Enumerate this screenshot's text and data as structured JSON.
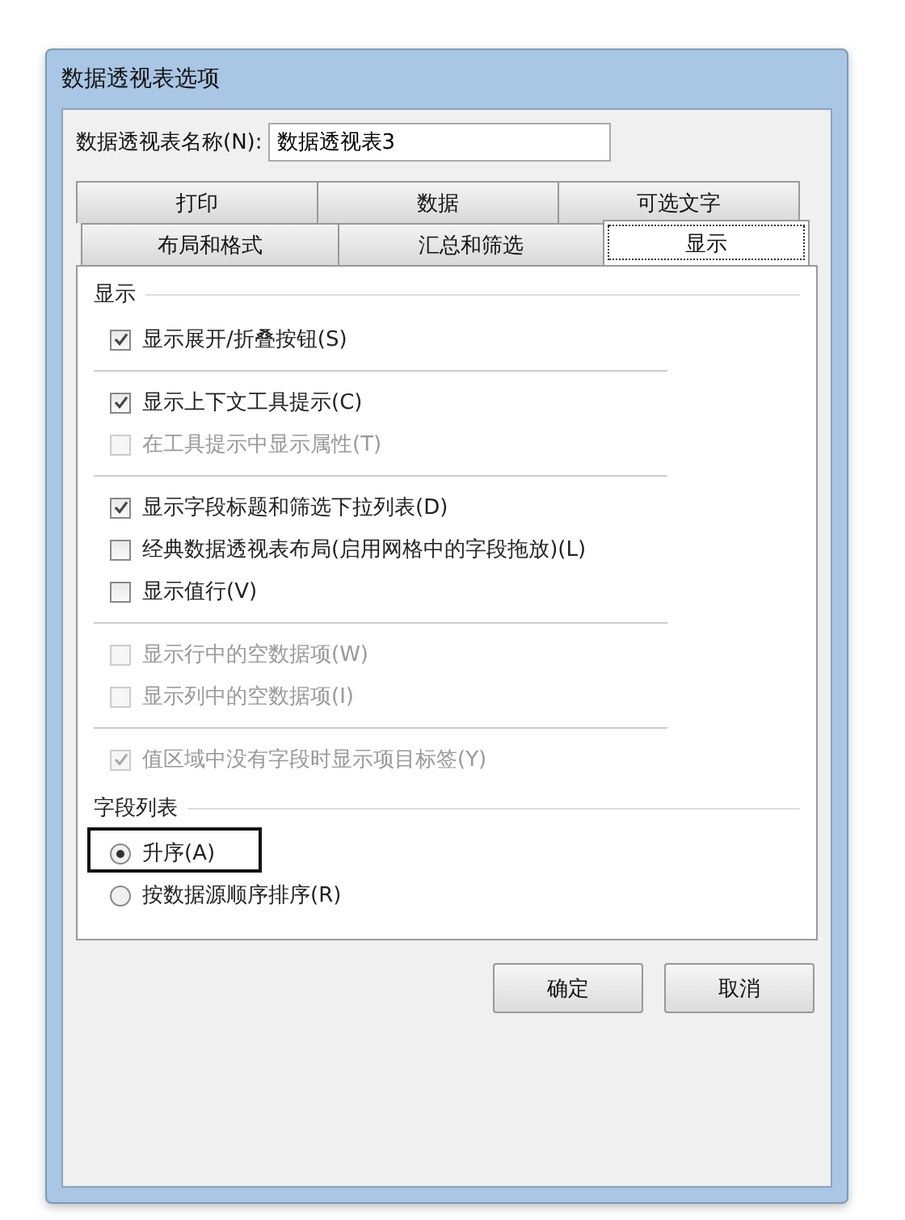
{
  "window": {
    "title": "数据透视表选项"
  },
  "name_field": {
    "label": "数据透视表名称(N):",
    "value": "数据透视表3"
  },
  "tab_rows": [
    [
      {
        "label": "打印",
        "selected": false
      },
      {
        "label": "数据",
        "selected": false
      },
      {
        "label": "可选文字",
        "selected": false
      }
    ],
    [
      {
        "label": "布局和格式",
        "selected": false
      },
      {
        "label": "汇总和筛选",
        "selected": false
      },
      {
        "label": "显示",
        "selected": true
      }
    ]
  ],
  "display_section": {
    "title": "显示",
    "groups": [
      [
        {
          "label": "显示展开/折叠按钮(S)",
          "checked": true,
          "disabled": false
        }
      ],
      [
        {
          "label": "显示上下文工具提示(C)",
          "checked": true,
          "disabled": false
        },
        {
          "label": "在工具提示中显示属性(T)",
          "checked": false,
          "disabled": true
        }
      ],
      [
        {
          "label": "显示字段标题和筛选下拉列表(D)",
          "checked": true,
          "disabled": false
        },
        {
          "label": "经典数据透视表布局(启用网格中的字段拖放)(L)",
          "checked": false,
          "disabled": false
        },
        {
          "label": "显示值行(V)",
          "checked": false,
          "disabled": false
        }
      ],
      [
        {
          "label": "显示行中的空数据项(W)",
          "checked": false,
          "disabled": true
        },
        {
          "label": "显示列中的空数据项(I)",
          "checked": false,
          "disabled": true
        }
      ],
      [
        {
          "label": "值区域中没有字段时显示项目标签(Y)",
          "checked": true,
          "disabled": true
        }
      ]
    ]
  },
  "field_list_section": {
    "title": "字段列表",
    "options": [
      {
        "label": "升序(A)",
        "selected": true,
        "highlighted": true
      },
      {
        "label": "按数据源顺序排序(R)",
        "selected": false,
        "highlighted": false
      }
    ]
  },
  "buttons": [
    "确定",
    "取消"
  ]
}
